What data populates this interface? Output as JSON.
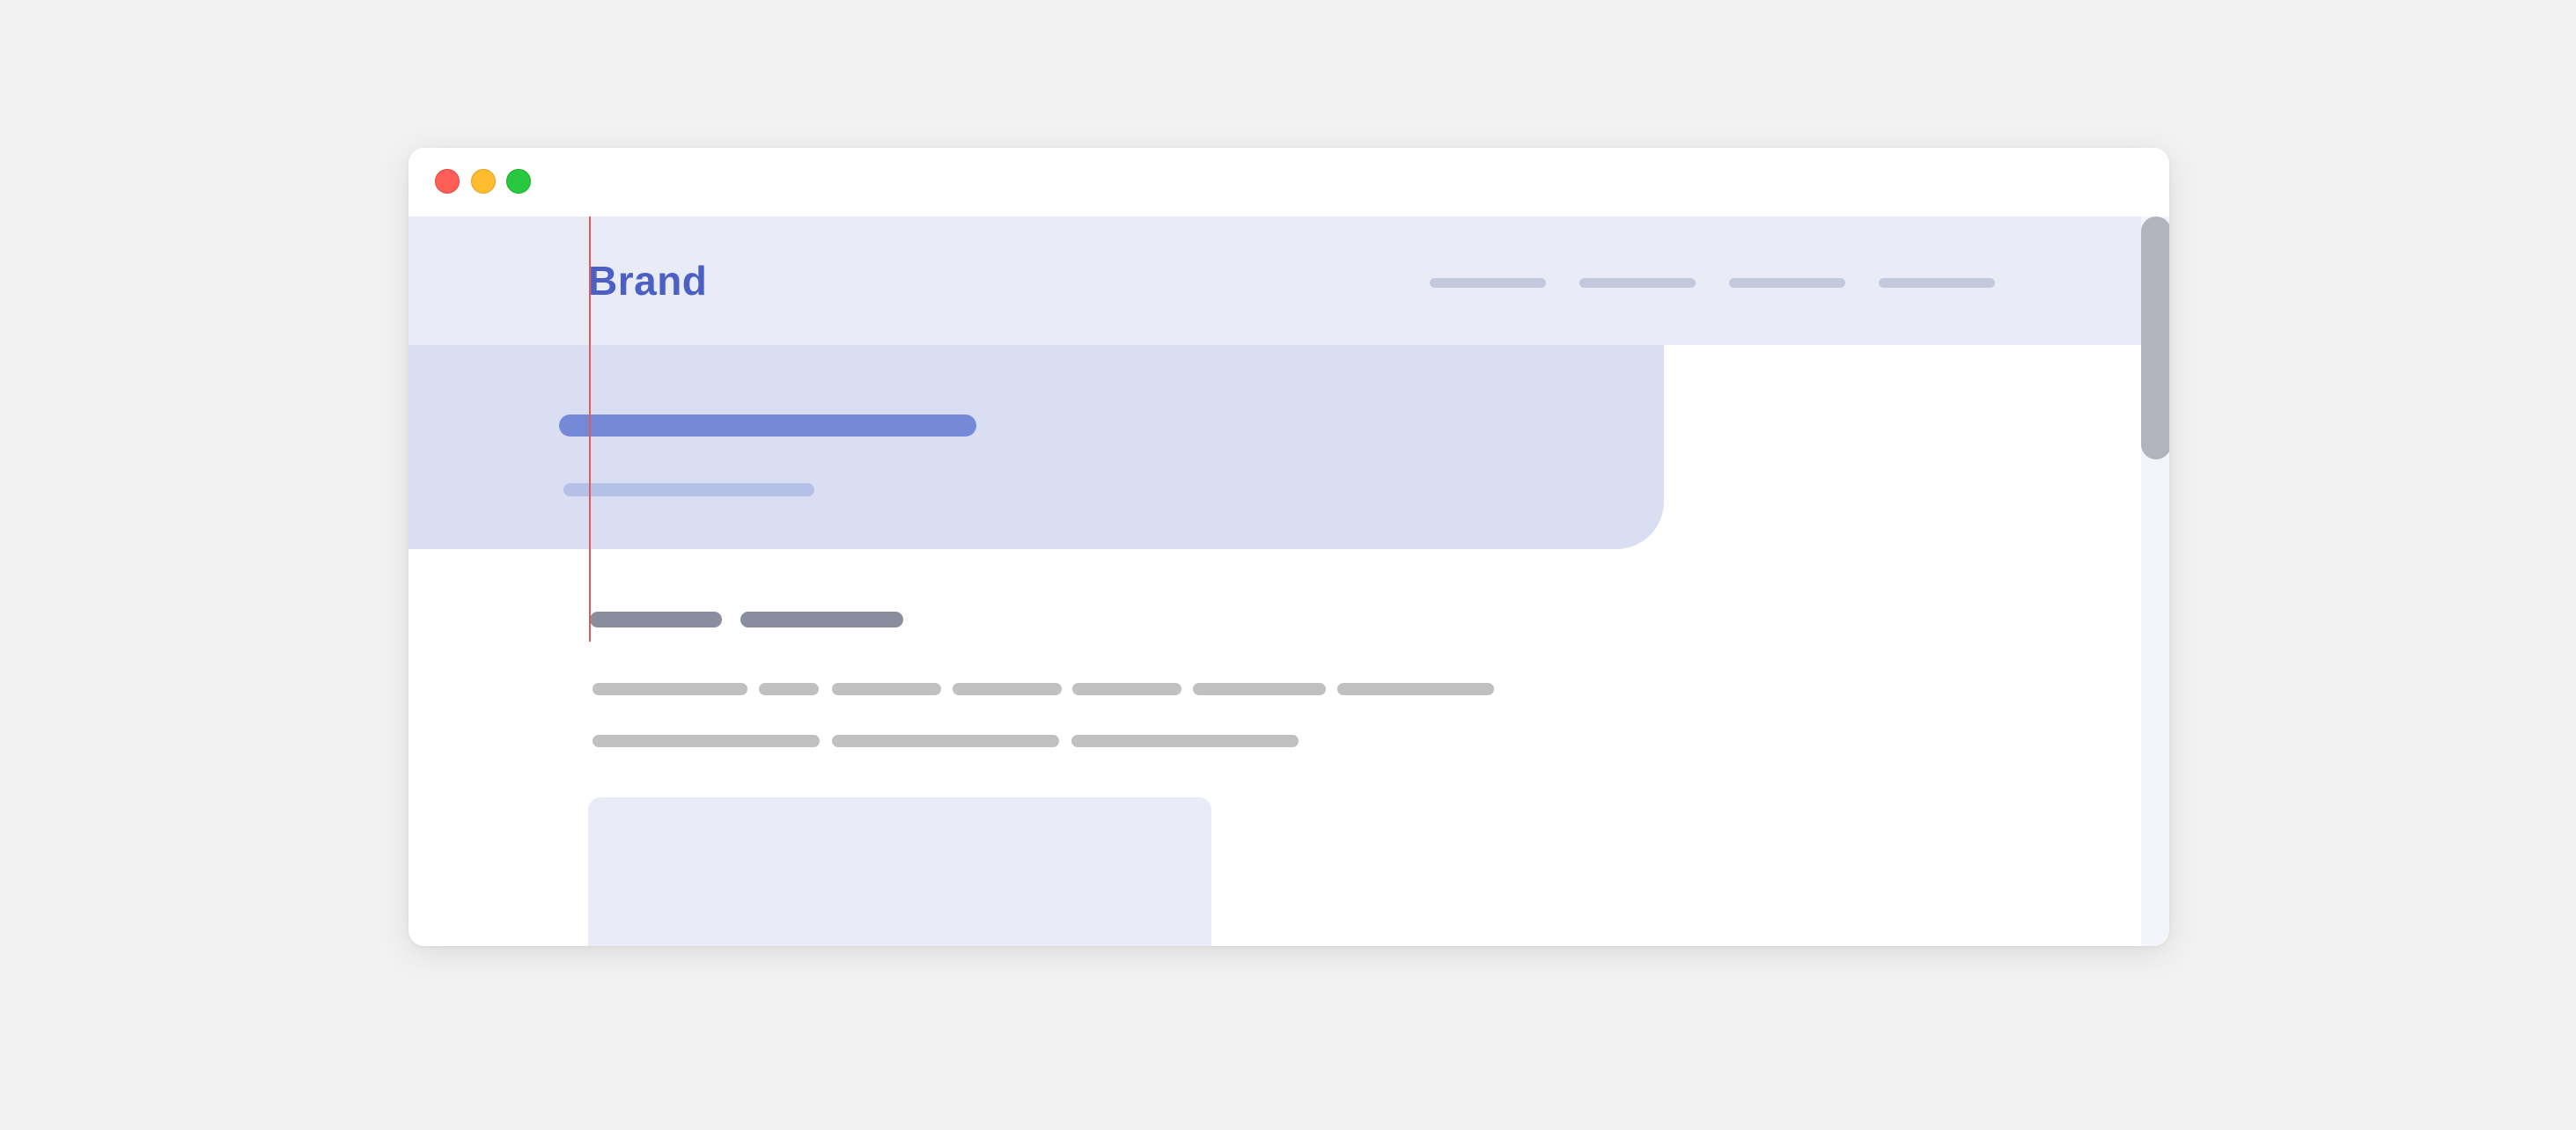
{
  "window": {
    "traffic_lights": {
      "close_color": "#fe5f57",
      "minimize_color": "#febc2e",
      "maximize_color": "#28c840"
    }
  },
  "navbar": {
    "brand": "Brand",
    "brand_color": "#4b5fc4",
    "background": "#e9ecf7",
    "link_count_visible": 4
  },
  "hero": {
    "background": "#d9def3",
    "title_placeholder_color": "#7489d8",
    "subtitle_placeholder_color": "#b5c0e6"
  },
  "content": {
    "heading_placeholder_color": "#8a8d9e",
    "text_placeholder_color": "#c0c0c0",
    "card_background": "#e9ecf7"
  },
  "editor": {
    "caret_color": "#e05a5a"
  },
  "scrollbar": {
    "thumb_color": "#b1b4bd",
    "track_color": "#f4f5fa",
    "scroll_position": 0
  }
}
